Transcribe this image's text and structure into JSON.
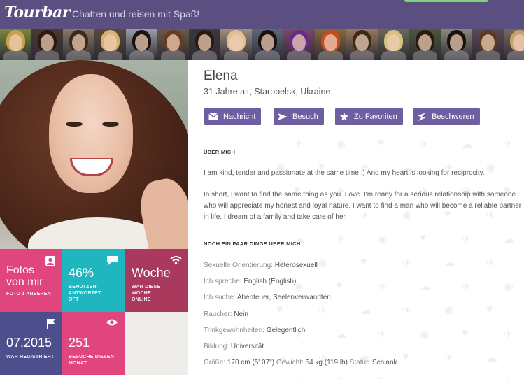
{
  "header": {
    "logo": "Tourbar",
    "tagline": "Chatten und reisen mit Spaß!"
  },
  "avatar_strip": {
    "count": 17
  },
  "photo": {
    "counter": "1"
  },
  "tiles": {
    "fotos": {
      "title": "Fotos von mir",
      "caption": "FOTO 1 ANSEHEN",
      "icon": "user-photo-icon"
    },
    "reply": {
      "value": "46%",
      "caption": "BENUTZER ANTWORTET OFT",
      "icon": "chat-bubble-icon"
    },
    "online": {
      "value": "Woche",
      "caption": "WAR DIESE WOCHE ONLINE",
      "icon": "wifi-icon"
    },
    "registered": {
      "value": "07.2015",
      "caption": "WAR REGISTRIERT",
      "icon": "flag-icon"
    },
    "visits": {
      "value": "251",
      "caption": "BESUCHE DIESEN MONAT",
      "icon": "eye-icon"
    }
  },
  "profile": {
    "name": "Elena",
    "subtitle": "31 Jahre alt, Starobelsk, Ukraine"
  },
  "actions": [
    {
      "label": "Nachricht",
      "icon": "envelope-icon"
    },
    {
      "label": "Besuch",
      "icon": "plane-icon"
    },
    {
      "label": "Zu Favoriten",
      "icon": "star-icon"
    },
    {
      "label": "Beschweren",
      "icon": "lightning-icon"
    }
  ],
  "about": {
    "heading": "ÜBER MICH",
    "p1": "I am kind, tender and passionate at the same time :) And my heart is looking for reciprocity.",
    "p2": "In short, I want to find the same thing as you. Love. I'm ready for a serious relationship with someone who will appreciate my honest and loyal nature. I want to find a man who will become a reliable partner in life. I dream of a family and take care of her."
  },
  "details": {
    "heading": "NOCH EIN PAAR DINGE ÜBER MICH",
    "orientation": {
      "label": "Sexuelle Orientierung:",
      "value": "Heterosexuell"
    },
    "languages": {
      "label": "Ich spreche:",
      "value": "English (English)"
    },
    "looking_for": {
      "label": "Ich suche:",
      "value": "Abenteuer, Seelenverwandten"
    },
    "smoker": {
      "label": "Raucher:",
      "value": "Nein"
    },
    "drinking": {
      "label": "Trinkgewohnheiten:",
      "value": "Gelegentlich"
    },
    "education": {
      "label": "Bildung:",
      "value": "Universität"
    },
    "size": {
      "label": "Größe:",
      "value": "170 cm (5' 07\")"
    },
    "weight": {
      "label": "Gewicht:",
      "value": "54 kg (119 lb)"
    },
    "status": {
      "label": "Statur:",
      "value": "Schlank"
    }
  },
  "colors": {
    "header": "#5b4f82",
    "button": "#6e5fa3",
    "tile_pink": "#e0457e",
    "tile_teal": "#1fb6bf",
    "tile_wine": "#a93a5e",
    "tile_navy": "#4d4f8d"
  }
}
